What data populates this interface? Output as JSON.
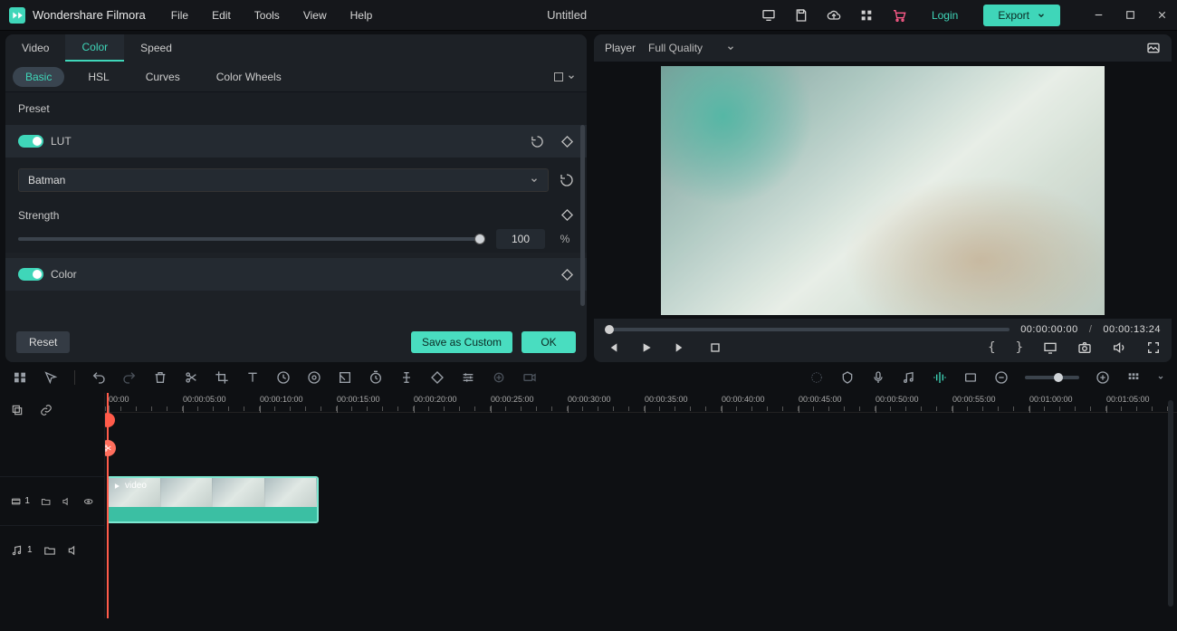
{
  "app": {
    "name": "Wondershare Filmora",
    "title": "Untitled"
  },
  "menu": [
    "File",
    "Edit",
    "Tools",
    "View",
    "Help"
  ],
  "title_right": {
    "login": "Login",
    "export": "Export"
  },
  "left": {
    "tabs1": [
      "Video",
      "Color",
      "Speed"
    ],
    "tabs1_active": 1,
    "tabs2": [
      "Basic",
      "HSL",
      "Curves",
      "Color Wheels"
    ],
    "tabs2_active": 0,
    "preset": "Preset",
    "lut": {
      "label": "LUT",
      "dropdown": "Batman"
    },
    "strength": {
      "label": "Strength",
      "value": "100",
      "unit": "%"
    },
    "color": {
      "label": "Color"
    },
    "buttons": {
      "reset": "Reset",
      "save_custom": "Save as Custom",
      "ok": "OK"
    }
  },
  "player": {
    "label": "Player",
    "quality": "Full Quality",
    "tc_current": "00:00:00:00",
    "tc_sep": "/",
    "tc_total": "00:00:13:24"
  },
  "timeline": {
    "ruler": [
      "00:00",
      "00:00:05:00",
      "00:00:10:00",
      "00:00:15:00",
      "00:00:20:00",
      "00:00:25:00",
      "00:00:30:00",
      "00:00:35:00",
      "00:00:40:00",
      "00:00:45:00",
      "00:00:50:00",
      "00:00:55:00",
      "00:01:00:00",
      "00:01:05:00"
    ],
    "clip_label": "video",
    "video_track_num": "1",
    "audio_track_num": "1"
  }
}
